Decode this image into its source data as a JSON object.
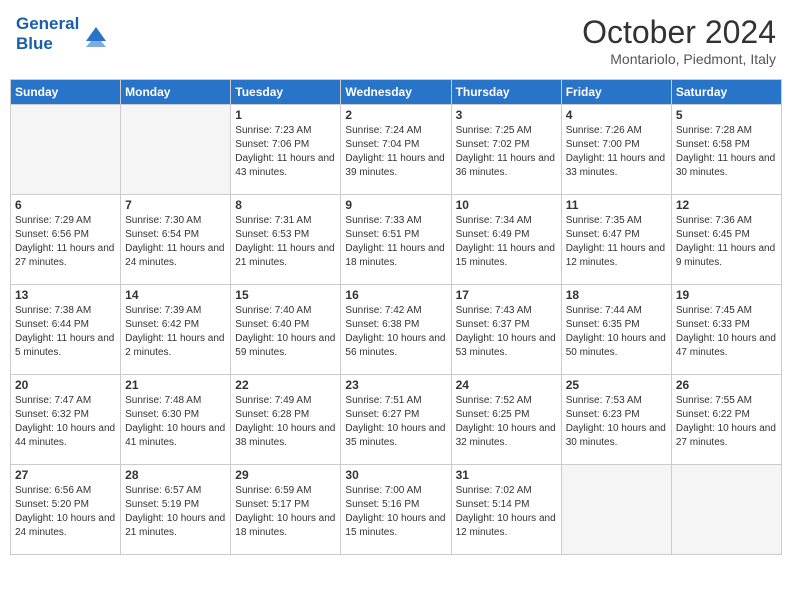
{
  "header": {
    "logo_line1": "General",
    "logo_line2": "Blue",
    "month": "October 2024",
    "location": "Montariolo, Piedmont, Italy"
  },
  "days_of_week": [
    "Sunday",
    "Monday",
    "Tuesday",
    "Wednesday",
    "Thursday",
    "Friday",
    "Saturday"
  ],
  "weeks": [
    [
      {
        "day": null
      },
      {
        "day": null
      },
      {
        "day": "1",
        "sunrise": "7:23 AM",
        "sunset": "7:06 PM",
        "daylight": "11 hours and 43 minutes."
      },
      {
        "day": "2",
        "sunrise": "7:24 AM",
        "sunset": "7:04 PM",
        "daylight": "11 hours and 39 minutes."
      },
      {
        "day": "3",
        "sunrise": "7:25 AM",
        "sunset": "7:02 PM",
        "daylight": "11 hours and 36 minutes."
      },
      {
        "day": "4",
        "sunrise": "7:26 AM",
        "sunset": "7:00 PM",
        "daylight": "11 hours and 33 minutes."
      },
      {
        "day": "5",
        "sunrise": "7:28 AM",
        "sunset": "6:58 PM",
        "daylight": "11 hours and 30 minutes."
      }
    ],
    [
      {
        "day": "6",
        "sunrise": "7:29 AM",
        "sunset": "6:56 PM",
        "daylight": "11 hours and 27 minutes."
      },
      {
        "day": "7",
        "sunrise": "7:30 AM",
        "sunset": "6:54 PM",
        "daylight": "11 hours and 24 minutes."
      },
      {
        "day": "8",
        "sunrise": "7:31 AM",
        "sunset": "6:53 PM",
        "daylight": "11 hours and 21 minutes."
      },
      {
        "day": "9",
        "sunrise": "7:33 AM",
        "sunset": "6:51 PM",
        "daylight": "11 hours and 18 minutes."
      },
      {
        "day": "10",
        "sunrise": "7:34 AM",
        "sunset": "6:49 PM",
        "daylight": "11 hours and 15 minutes."
      },
      {
        "day": "11",
        "sunrise": "7:35 AM",
        "sunset": "6:47 PM",
        "daylight": "11 hours and 12 minutes."
      },
      {
        "day": "12",
        "sunrise": "7:36 AM",
        "sunset": "6:45 PM",
        "daylight": "11 hours and 9 minutes."
      }
    ],
    [
      {
        "day": "13",
        "sunrise": "7:38 AM",
        "sunset": "6:44 PM",
        "daylight": "11 hours and 5 minutes."
      },
      {
        "day": "14",
        "sunrise": "7:39 AM",
        "sunset": "6:42 PM",
        "daylight": "11 hours and 2 minutes."
      },
      {
        "day": "15",
        "sunrise": "7:40 AM",
        "sunset": "6:40 PM",
        "daylight": "10 hours and 59 minutes."
      },
      {
        "day": "16",
        "sunrise": "7:42 AM",
        "sunset": "6:38 PM",
        "daylight": "10 hours and 56 minutes."
      },
      {
        "day": "17",
        "sunrise": "7:43 AM",
        "sunset": "6:37 PM",
        "daylight": "10 hours and 53 minutes."
      },
      {
        "day": "18",
        "sunrise": "7:44 AM",
        "sunset": "6:35 PM",
        "daylight": "10 hours and 50 minutes."
      },
      {
        "day": "19",
        "sunrise": "7:45 AM",
        "sunset": "6:33 PM",
        "daylight": "10 hours and 47 minutes."
      }
    ],
    [
      {
        "day": "20",
        "sunrise": "7:47 AM",
        "sunset": "6:32 PM",
        "daylight": "10 hours and 44 minutes."
      },
      {
        "day": "21",
        "sunrise": "7:48 AM",
        "sunset": "6:30 PM",
        "daylight": "10 hours and 41 minutes."
      },
      {
        "day": "22",
        "sunrise": "7:49 AM",
        "sunset": "6:28 PM",
        "daylight": "10 hours and 38 minutes."
      },
      {
        "day": "23",
        "sunrise": "7:51 AM",
        "sunset": "6:27 PM",
        "daylight": "10 hours and 35 minutes."
      },
      {
        "day": "24",
        "sunrise": "7:52 AM",
        "sunset": "6:25 PM",
        "daylight": "10 hours and 32 minutes."
      },
      {
        "day": "25",
        "sunrise": "7:53 AM",
        "sunset": "6:23 PM",
        "daylight": "10 hours and 30 minutes."
      },
      {
        "day": "26",
        "sunrise": "7:55 AM",
        "sunset": "6:22 PM",
        "daylight": "10 hours and 27 minutes."
      }
    ],
    [
      {
        "day": "27",
        "sunrise": "6:56 AM",
        "sunset": "5:20 PM",
        "daylight": "10 hours and 24 minutes."
      },
      {
        "day": "28",
        "sunrise": "6:57 AM",
        "sunset": "5:19 PM",
        "daylight": "10 hours and 21 minutes."
      },
      {
        "day": "29",
        "sunrise": "6:59 AM",
        "sunset": "5:17 PM",
        "daylight": "10 hours and 18 minutes."
      },
      {
        "day": "30",
        "sunrise": "7:00 AM",
        "sunset": "5:16 PM",
        "daylight": "10 hours and 15 minutes."
      },
      {
        "day": "31",
        "sunrise": "7:02 AM",
        "sunset": "5:14 PM",
        "daylight": "10 hours and 12 minutes."
      },
      {
        "day": null
      },
      {
        "day": null
      }
    ]
  ]
}
